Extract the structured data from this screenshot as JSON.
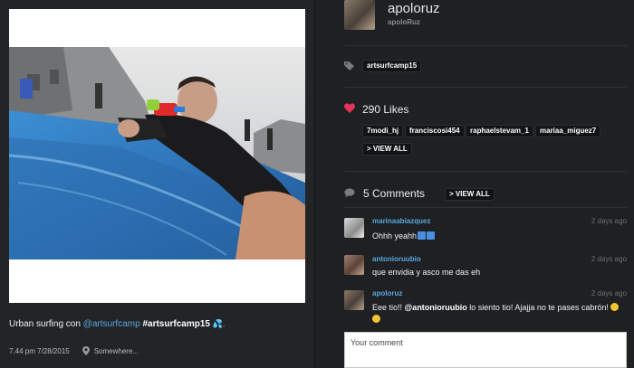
{
  "post": {
    "caption_text": "Urban surfing con ",
    "caption_mention": "@artsurfcamp",
    "caption_hashtag": "#artsurfcamp15",
    "caption_emoji": "💦.",
    "time": "7.44 pm 7/28/2015",
    "location": "Somewhere..."
  },
  "author": {
    "username": "apoloruz",
    "handle": "apoloRuz"
  },
  "tags": [
    "artsurfcamp15"
  ],
  "likes": {
    "count_label": "290 Likes",
    "users": [
      "7modi_hj",
      "franciscosi454",
      "raphaelstevam_1",
      "mariaa_miguez7"
    ],
    "view_all": "> VIEW ALL"
  },
  "comments": {
    "title": "5 Comments",
    "view_all": "> VIEW ALL",
    "items": [
      {
        "user": "marinaabiazquez",
        "time": "2 days ago",
        "text": "Ohhh yeahh"
      },
      {
        "user": "antonioruubio",
        "time": "2 days ago",
        "text": "que envidia y asco me das eh"
      },
      {
        "user": "apoloruz",
        "time": "2 days ago",
        "text_pre": "Eee tio!! ",
        "mention": "@antonioruubio",
        "text_post": " lo siento tio! Ajajja no te pases cabrón! "
      }
    ],
    "input_placeholder": "Your comment"
  },
  "colors": {
    "background": "#1d1f21",
    "link": "#57a8e0",
    "heart": "#e8335a"
  },
  "icons": [
    "location-pin-icon",
    "tag-icon",
    "heart-icon",
    "comment-bubble-icon",
    "emoji-icon"
  ]
}
